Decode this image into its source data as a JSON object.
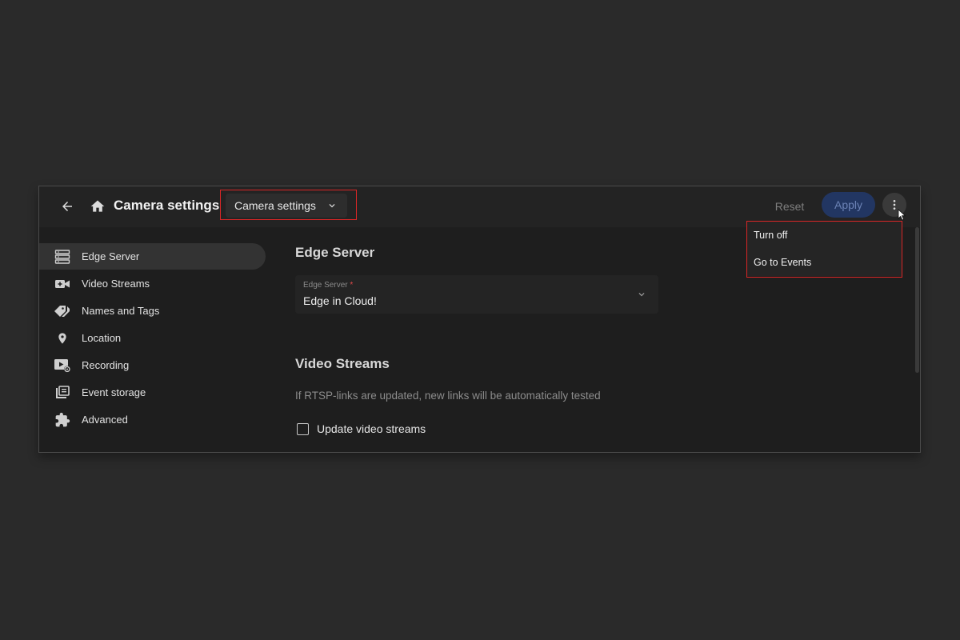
{
  "header": {
    "title": "Camera settings",
    "breadcrumb_value": "Camera settings",
    "reset_label": "Reset",
    "apply_label": "Apply"
  },
  "sidebar": {
    "items": [
      {
        "label": "Edge Server",
        "icon": "server-icon",
        "active": true
      },
      {
        "label": "Video Streams",
        "icon": "video-camera-icon"
      },
      {
        "label": "Names and Tags",
        "icon": "tags-icon"
      },
      {
        "label": "Location",
        "icon": "location-pin-icon"
      },
      {
        "label": "Recording",
        "icon": "recording-icon"
      },
      {
        "label": "Event storage",
        "icon": "event-storage-icon"
      },
      {
        "label": "Advanced",
        "icon": "puzzle-icon"
      }
    ]
  },
  "main": {
    "edge_section_title": "Edge Server",
    "edge_field": {
      "label": "Edge Server",
      "required_mark": "*",
      "value": "Edge in Cloud!"
    },
    "video_section_title": "Video Streams",
    "video_hint": "If RTSP-links are updated, new links will be automatically tested",
    "update_streams_label": "Update video streams"
  },
  "more_menu": {
    "items": [
      {
        "label": "Turn off"
      },
      {
        "label": "Go to Events"
      }
    ]
  },
  "colors": {
    "background": "#2a2a2a",
    "panel": "#1e1e1e",
    "header": "#232323",
    "accent_apply": "#223662",
    "highlight": "#d92626"
  }
}
